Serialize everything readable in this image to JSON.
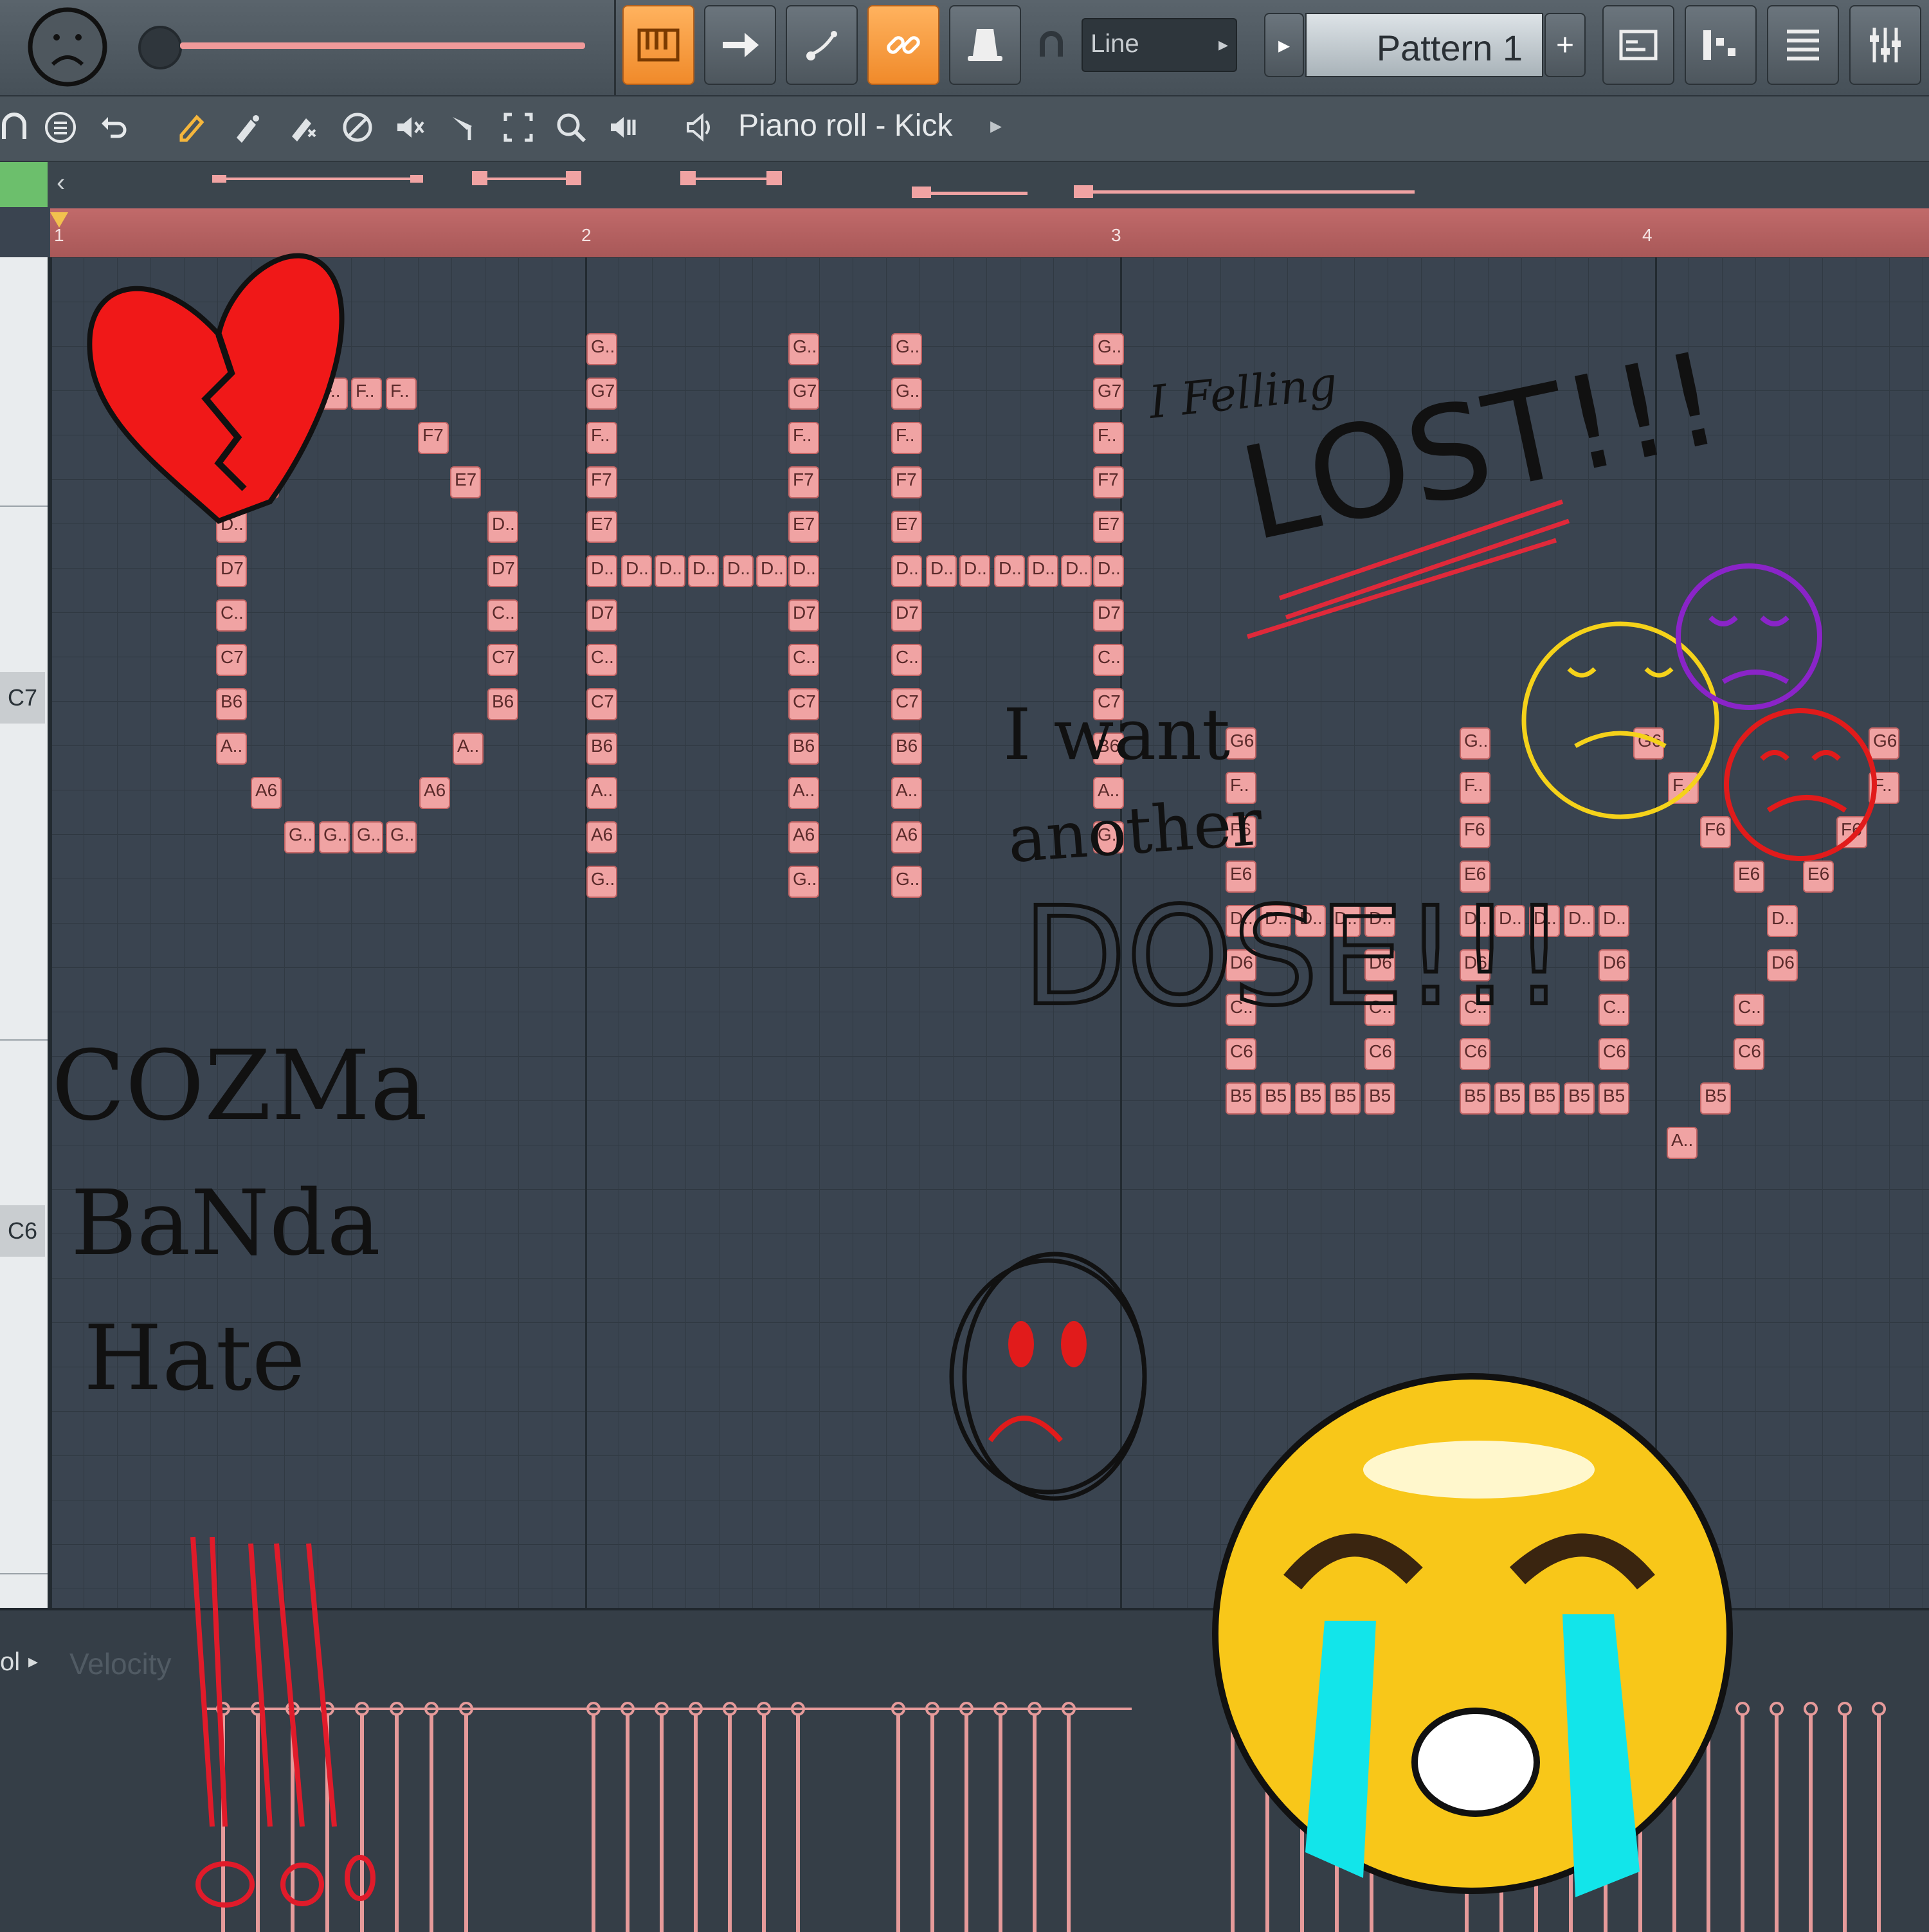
{
  "toolbar": {
    "snap_mode_value": "Line",
    "pattern_value": "Pattern 1",
    "add_pattern_label": "+"
  },
  "piano_roll": {
    "title": "Piano roll - Kick",
    "bar_numbers": [
      "1",
      "2",
      "3",
      "4"
    ],
    "key_labels": [
      "C7",
      "C6"
    ]
  },
  "velocity_panel": {
    "control_label": "ol",
    "target_label": "Velocity"
  },
  "notes": {
    "O": [
      "F..",
      "F..",
      "F..",
      "F7",
      "E7",
      "E7",
      "D..",
      "D..",
      "D7",
      "D7",
      "C..",
      "C..",
      "C7",
      "C7",
      "B6",
      "B6",
      "A..",
      "A..",
      "A6",
      "A6",
      "G..",
      "G..",
      "G..",
      "G.."
    ],
    "H1": [
      "G..",
      "G7",
      "F..",
      "F7",
      "E7",
      "D..",
      "D7",
      "C..",
      "C7",
      "B6",
      "A..",
      "A6",
      "G..",
      "G..",
      "G7",
      "F..",
      "F7",
      "E7",
      "D..",
      "D7",
      "C..",
      "C7",
      "B6",
      "A..",
      "A6",
      "G..",
      "D..",
      "D..",
      "D..",
      "D..",
      "D.."
    ],
    "H2": [
      "G..",
      "G..",
      "F..",
      "F7",
      "E7",
      "D..",
      "D7",
      "C..",
      "C7",
      "B6",
      "A..",
      "A6",
      "G..",
      "G..",
      "G7",
      "F..",
      "F7",
      "E7",
      "D..",
      "D7",
      "C..",
      "C7",
      "B6",
      "A..",
      "G..",
      "D..",
      "D..",
      "D..",
      "D..",
      "D.."
    ],
    "b1": [
      "G6",
      "F..",
      "F6",
      "E6",
      "D..",
      "D..",
      "D..",
      "D..",
      "D..",
      "D6",
      "D6",
      "C..",
      "C..",
      "C6",
      "C6",
      "B5",
      "B5",
      "B5",
      "B5",
      "B5"
    ],
    "b2": [
      "G..",
      "F..",
      "F6",
      "E6",
      "D..",
      "D..",
      "D..",
      "D..",
      "D..",
      "D6",
      "D6",
      "C..",
      "C..",
      "C6",
      "C6",
      "B5",
      "B5",
      "B5",
      "B5",
      "B5"
    ],
    "y": [
      "G6",
      "F..",
      "F6",
      "E6",
      "D..",
      "D6",
      "C..",
      "C6",
      "B5",
      "A..",
      "G6",
      "F..",
      "F6",
      "E6"
    ]
  },
  "doodles": {
    "left_text": [
      "COZMa",
      "BaNda",
      "Hate"
    ],
    "lost_text": [
      "I Felling",
      "LOST!!!"
    ],
    "dose_text": [
      "I want",
      "another",
      "DOSE!!!"
    ]
  },
  "colors": {
    "note_fill": "#f0a3a3",
    "ruler": "#b46060",
    "accent_orange": "#f59a3a"
  }
}
